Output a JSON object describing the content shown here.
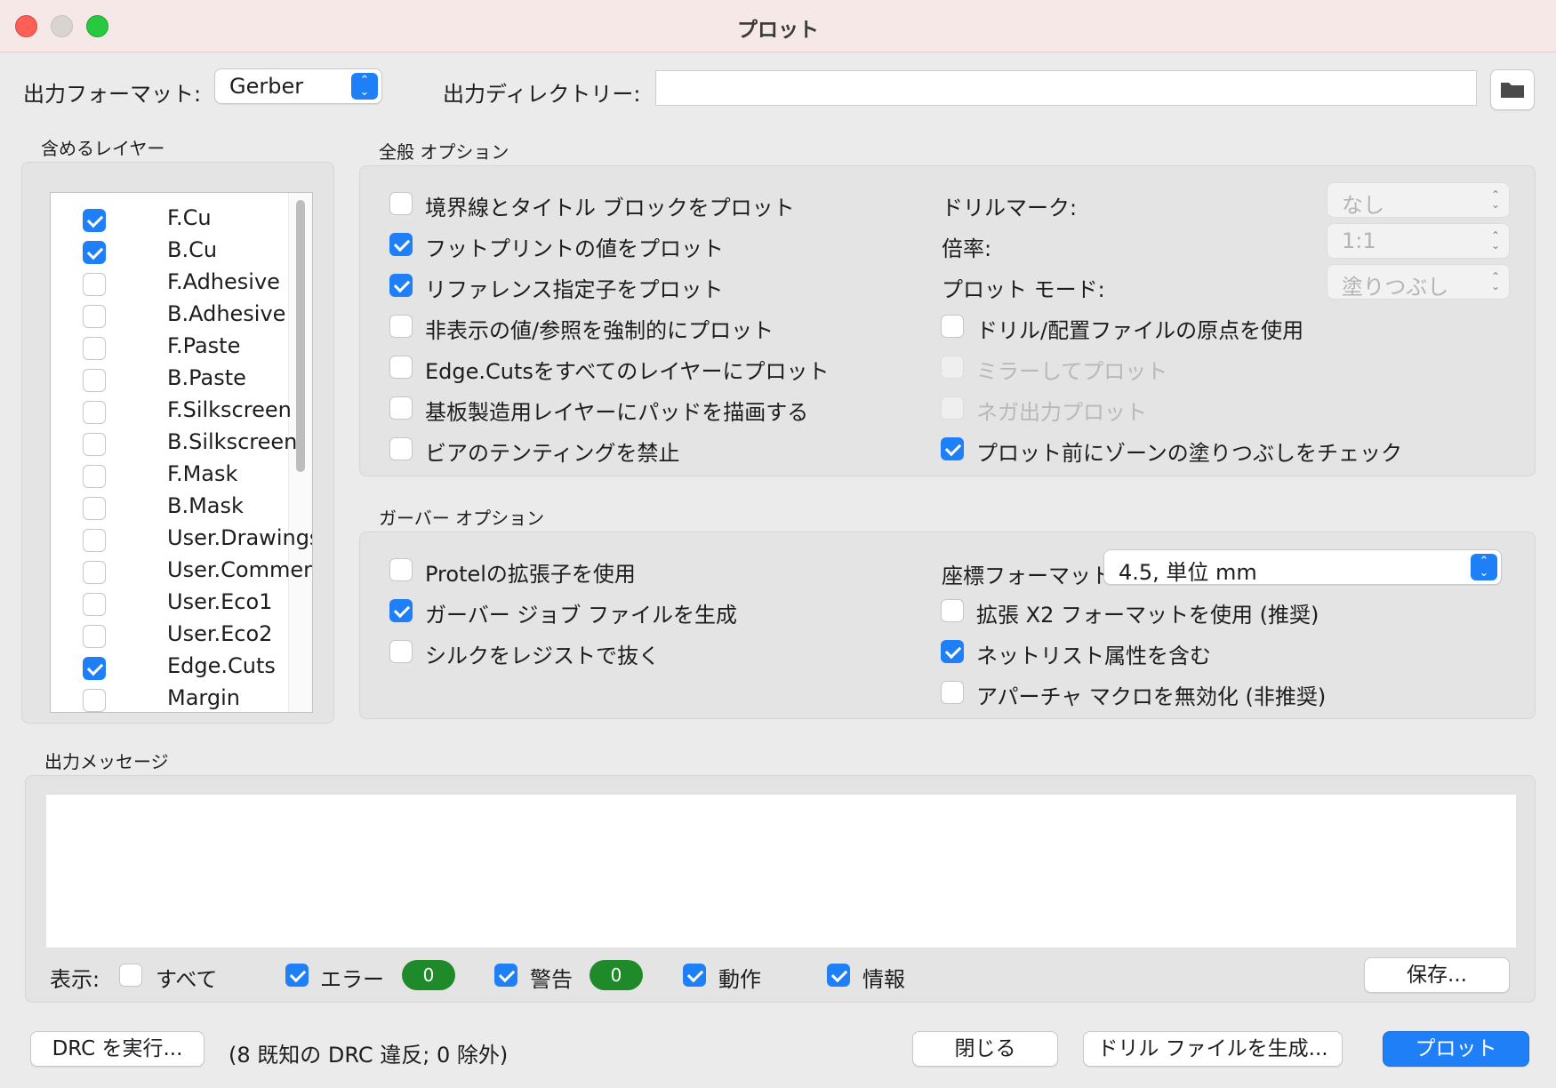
{
  "window": {
    "title": "プロット"
  },
  "top": {
    "format_label": "出力フォーマット:",
    "format_value": "Gerber",
    "dir_label": "出力ディレクトリー:",
    "dir_value": ""
  },
  "layers": {
    "title": "含めるレイヤー",
    "items": [
      {
        "name": "F.Cu",
        "checked": true
      },
      {
        "name": "B.Cu",
        "checked": true
      },
      {
        "name": "F.Adhesive",
        "checked": false
      },
      {
        "name": "B.Adhesive",
        "checked": false
      },
      {
        "name": "F.Paste",
        "checked": false
      },
      {
        "name": "B.Paste",
        "checked": false
      },
      {
        "name": "F.Silkscreen",
        "checked": false
      },
      {
        "name": "B.Silkscreen",
        "checked": false
      },
      {
        "name": "F.Mask",
        "checked": false
      },
      {
        "name": "B.Mask",
        "checked": false
      },
      {
        "name": "User.Drawings",
        "checked": false
      },
      {
        "name": "User.Comments",
        "checked": false
      },
      {
        "name": "User.Eco1",
        "checked": false
      },
      {
        "name": "User.Eco2",
        "checked": false
      },
      {
        "name": "Edge.Cuts",
        "checked": true
      },
      {
        "name": "Margin",
        "checked": false
      }
    ]
  },
  "general": {
    "title": "全般 オプション",
    "left": [
      {
        "label": "境界線とタイトル ブロックをプロット",
        "checked": false
      },
      {
        "label": "フットプリントの値をプロット",
        "checked": true
      },
      {
        "label": "リファレンス指定子をプロット",
        "checked": true
      },
      {
        "label": "非表示の値/参照を強制的にプロット",
        "checked": false
      },
      {
        "label": "Edge.Cutsをすべてのレイヤーにプロット",
        "checked": false
      },
      {
        "label": "基板製造用レイヤーにパッドを描画する",
        "checked": false
      },
      {
        "label": "ビアのテンティングを禁止",
        "checked": false
      }
    ],
    "drill_label": "ドリルマーク:",
    "drill_value": "なし",
    "scale_label": "倍率:",
    "scale_value": "1:1",
    "mode_label": "プロット モード:",
    "mode_value": "塗りつぶし",
    "right": [
      {
        "label": "ドリル/配置ファイルの原点を使用",
        "checked": false,
        "disabled": false
      },
      {
        "label": "ミラーしてプロット",
        "checked": false,
        "disabled": true
      },
      {
        "label": "ネガ出力プロット",
        "checked": false,
        "disabled": true
      },
      {
        "label": "プロット前にゾーンの塗りつぶしをチェック",
        "checked": true,
        "disabled": false
      }
    ]
  },
  "gerber": {
    "title": "ガーバー オプション",
    "left": [
      {
        "label": "Protelの拡張子を使用",
        "checked": false
      },
      {
        "label": "ガーバー ジョブ ファイルを生成",
        "checked": true
      },
      {
        "label": "シルクをレジストで抜く",
        "checked": false
      }
    ],
    "coord_label": "座標フォーマット:",
    "coord_value": "4.5, 単位 mm",
    "right": [
      {
        "label": "拡張 X2 フォーマットを使用 (推奨)",
        "checked": false
      },
      {
        "label": "ネットリスト属性を含む",
        "checked": true
      },
      {
        "label": "アパーチャ マクロを無効化 (非推奨)",
        "checked": false
      }
    ]
  },
  "messages": {
    "title": "出力メッセージ",
    "show_label": "表示:",
    "filters": [
      {
        "label": "すべて",
        "checked": false
      },
      {
        "label": "エラー",
        "checked": true,
        "count": "0"
      },
      {
        "label": "警告",
        "checked": true,
        "count": "0"
      },
      {
        "label": "動作",
        "checked": true
      },
      {
        "label": "情報",
        "checked": true
      }
    ],
    "save_label": "保存..."
  },
  "bottom": {
    "drc_label": "DRC を実行...",
    "drc_status": "(8 既知の DRC 違反; 0 除外)",
    "close_label": "閉じる",
    "drill_label": "ドリル ファイルを生成...",
    "plot_label": "プロット"
  },
  "colors": {
    "accent": "#1f7ff7",
    "badge": "#1e8a2a"
  },
  "icons": {
    "folder": "folder-icon"
  }
}
